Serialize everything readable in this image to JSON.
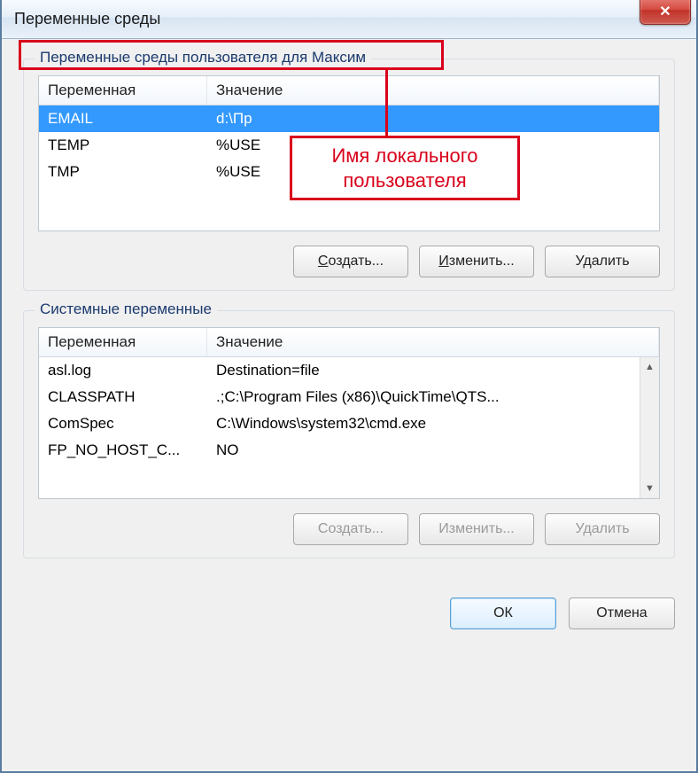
{
  "window": {
    "title": "Переменные среды",
    "close_tooltip": "Закрыть"
  },
  "user_group": {
    "legend": "Переменные среды пользователя для Максим",
    "columns": {
      "var": "Переменная",
      "val": "Значение"
    },
    "rows": [
      {
        "var": "EMAIL",
        "val": "d:\\Пр",
        "selected": true
      },
      {
        "var": "TEMP",
        "val": "%USE",
        "selected": false
      },
      {
        "var": "TMP",
        "val": "%USE",
        "selected": false
      }
    ],
    "buttons": {
      "create": "Создать...",
      "edit": "Изменить...",
      "delete": "Удалить"
    }
  },
  "system_group": {
    "legend": "Системные переменные",
    "columns": {
      "var": "Переменная",
      "val": "Значение"
    },
    "rows": [
      {
        "var": "asl.log",
        "val": "Destination=file"
      },
      {
        "var": "CLASSPATH",
        "val": ".;C:\\Program Files (x86)\\QuickTime\\QTS..."
      },
      {
        "var": "ComSpec",
        "val": "C:\\Windows\\system32\\cmd.exe"
      },
      {
        "var": "FP_NO_HOST_C...",
        "val": "NO"
      }
    ],
    "buttons": {
      "create": "Создать...",
      "edit": "Изменить...",
      "delete": "Удалить"
    }
  },
  "dialog_buttons": {
    "ok": "ОК",
    "cancel": "Отмена"
  },
  "annotation": {
    "callout_line1": "Имя локального",
    "callout_line2": "пользователя"
  }
}
